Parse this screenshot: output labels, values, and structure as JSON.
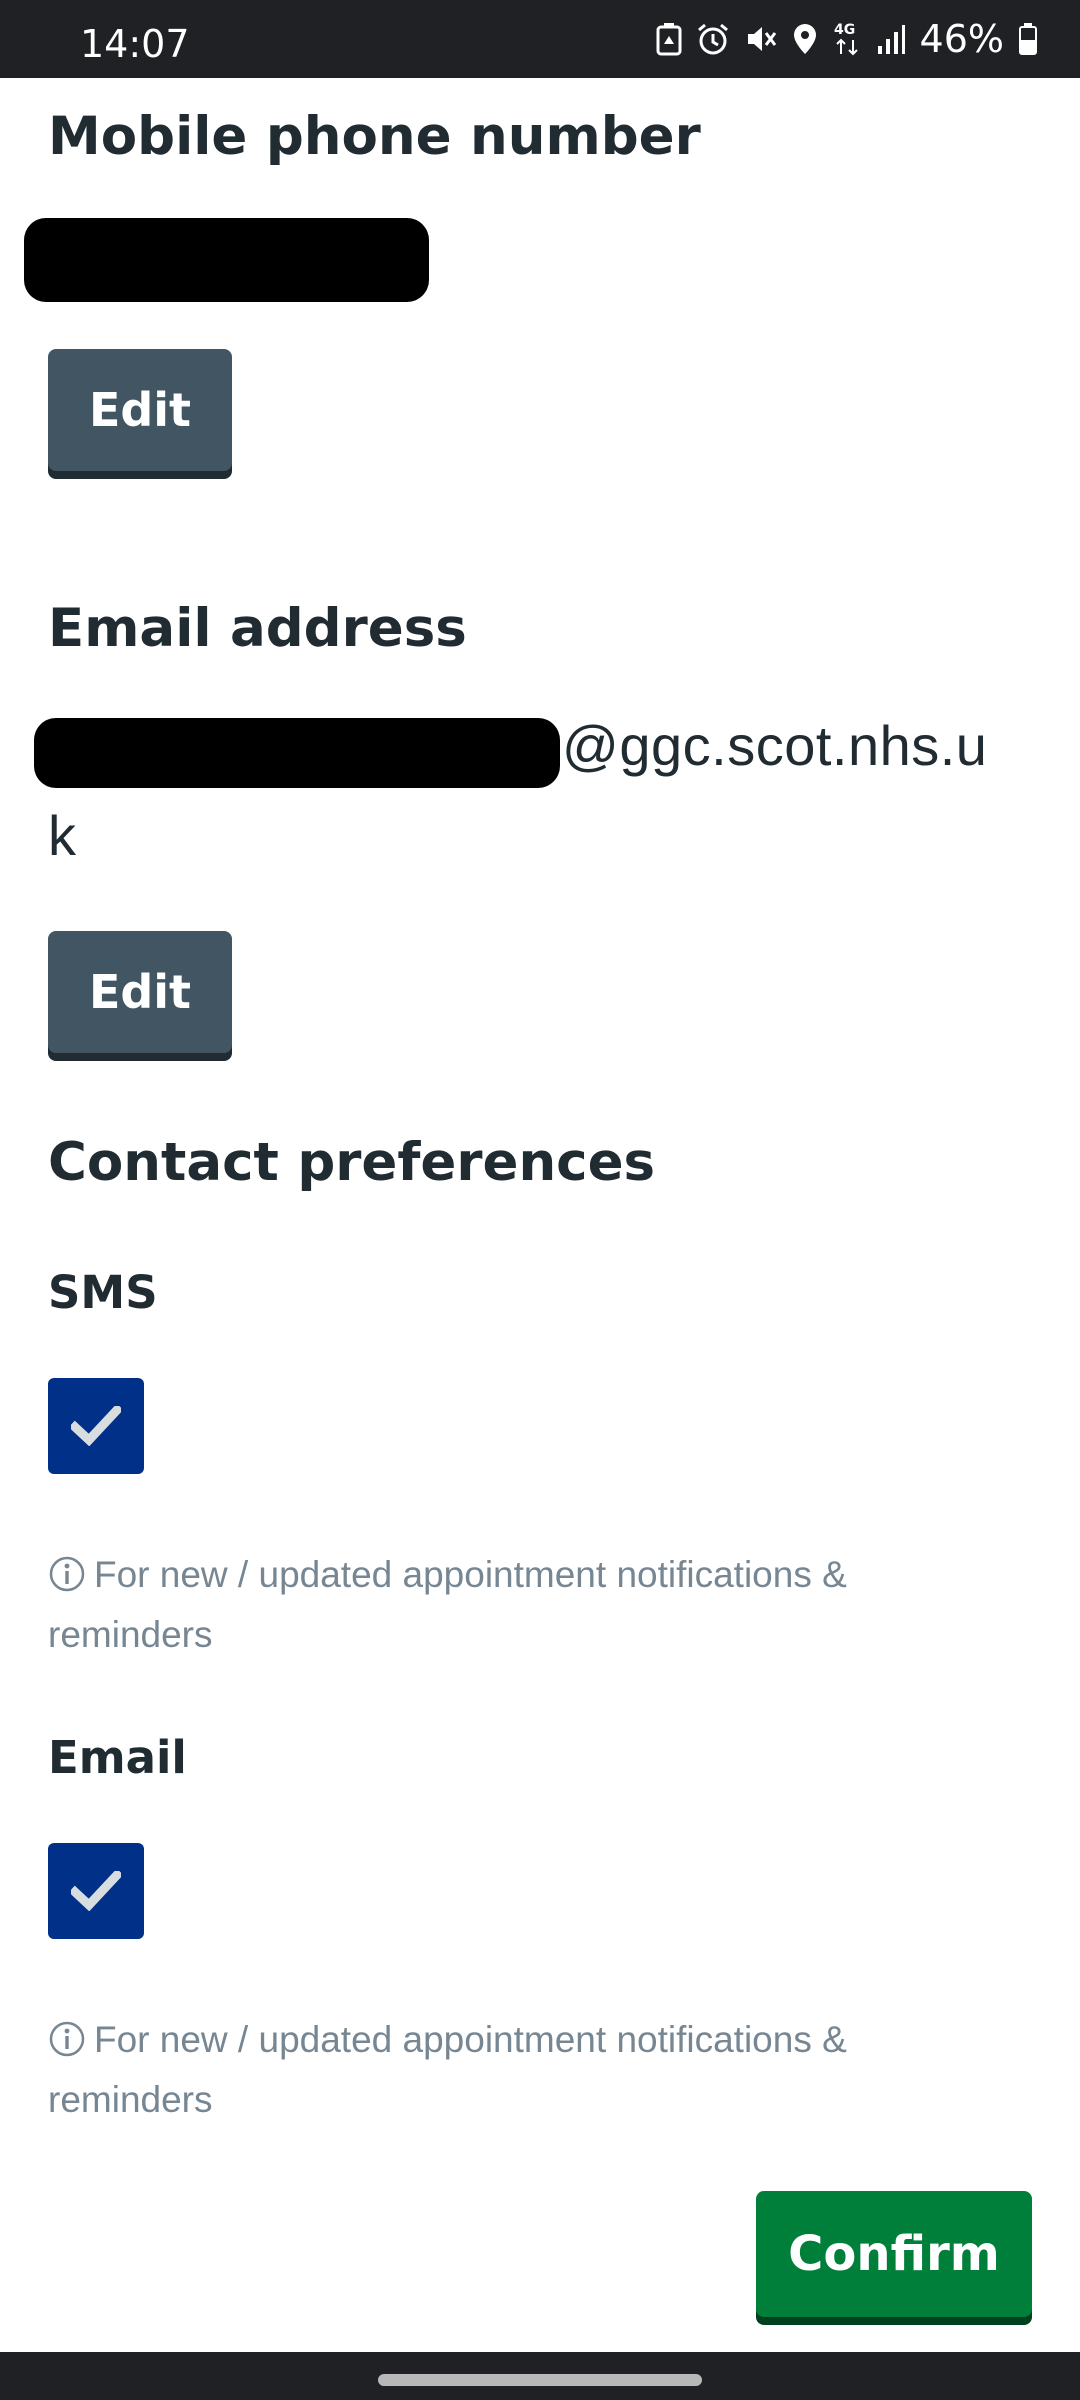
{
  "status_bar": {
    "time": "14:07",
    "battery_text": "46%",
    "icons": [
      "battery-saver-icon",
      "alarm-icon",
      "mute-icon",
      "location-icon",
      "4g-data-icon",
      "signal-icon",
      "battery-icon"
    ]
  },
  "mobile": {
    "heading": "Mobile phone number",
    "edit_label": "Edit"
  },
  "email": {
    "heading": "Email address",
    "value_domain": "@ggc.scot.nhs.u",
    "value_wrap": "k",
    "edit_label": "Edit"
  },
  "preferences": {
    "heading": "Contact preferences",
    "sms": {
      "label": "SMS",
      "checked": true,
      "hint": "For new / updated appointment notifications & reminders"
    },
    "email": {
      "label": "Email",
      "checked": true,
      "hint": "For new / updated appointment notifications & reminders"
    }
  },
  "actions": {
    "confirm_label": "Confirm"
  },
  "colors": {
    "status_bar": "#1f2124",
    "heading_text": "#212b32",
    "edit_button": "#425563",
    "checkbox": "#003087",
    "hint_text": "#768692",
    "confirm_button": "#007f3b"
  }
}
